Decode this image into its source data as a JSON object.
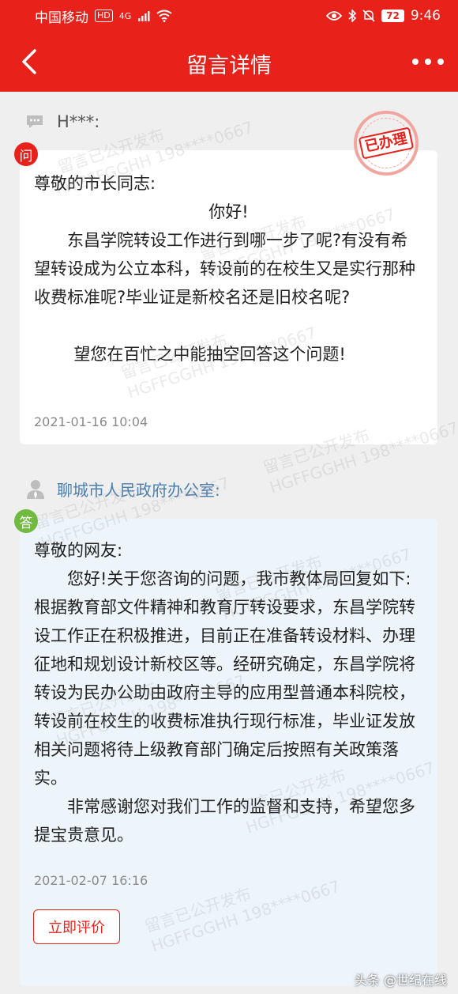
{
  "status_bar": {
    "carrier": "中国移动",
    "hd_badge": "HD",
    "network": "4G",
    "battery": "72",
    "time": "9:46"
  },
  "header": {
    "title": "留言详情"
  },
  "watermark": {
    "line1": "留言已公开发布",
    "line2": "HGFFGGHH 198****0667"
  },
  "question": {
    "asker": "H***:",
    "badge": "问",
    "stamp": "已办理",
    "greeting": "尊敬的市长同志:",
    "hello": "你好!",
    "body": "东昌学院转设工作进行到哪一步了呢?有没有希望转设成为公立本科，转设前的在校生又是实行那种收费标准呢?毕业证是新校名还是旧校名呢?",
    "closing": "望您在百忙之中能抽空回答这个问题!",
    "date": "2021-01-16 10:04"
  },
  "answer": {
    "responder": "聊城市人民政府办公室:",
    "badge": "答",
    "greeting": "尊敬的网友:",
    "body": "您好!关于您咨询的问题，我市教体局回复如下:根据教育部文件精神和教育厅转设要求，东昌学院转设工作正在积极推进，目前正在准备转设材料、办理征地和规划设计新校区等。经研究确定，东昌学院将转设为民办公助由政府主导的应用型普通本科院校，转设前在校生的收费标准执行现行标准，毕业证发放相关问题将待上级教育部门确定后按照有关政策落实。",
    "thanks": "非常感谢您对我们工作的监督和支持，希望您多提宝贵意见。",
    "date": "2021-02-07 16:16",
    "rate_label": "立即评价"
  },
  "footer": {
    "source": "头条 @世纪在线"
  },
  "colors": {
    "brand": "#e8211b",
    "answer_bg": "#edf5fb",
    "answer_badge": "#6fba3f",
    "responder": "#4a7fb0"
  }
}
